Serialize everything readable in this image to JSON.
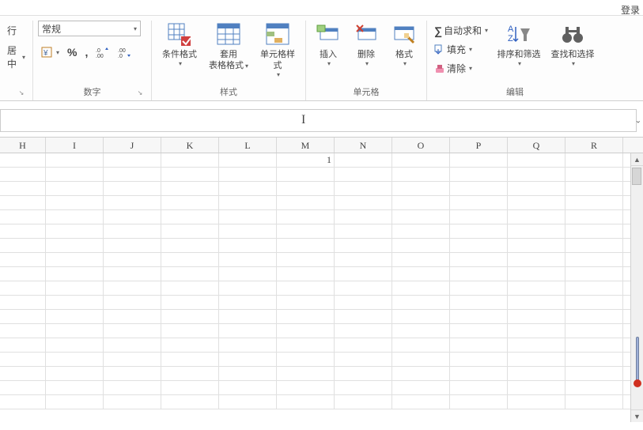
{
  "topbar": {
    "login_label": "登录"
  },
  "ribbon": {
    "alignment": {
      "wrap_label": "行",
      "merge_label": "居中",
      "group_label": ""
    },
    "number": {
      "format_selected": "常规",
      "group_label": "数字"
    },
    "styles": {
      "conditional_label": "条件格式",
      "table_format_label1": "套用",
      "table_format_label2": "表格格式",
      "cell_style_label": "单元格样式",
      "group_label": "样式"
    },
    "cells": {
      "insert_label": "插入",
      "delete_label": "删除",
      "format_label": "格式",
      "group_label": "单元格"
    },
    "editing": {
      "autosum_label": "自动求和",
      "fill_label": "填充",
      "clear_label": "清除",
      "sort_filter_label": "排序和筛选",
      "find_select_label": "查找和选择",
      "group_label": "编辑"
    }
  },
  "columns": [
    "H",
    "I",
    "J",
    "K",
    "L",
    "M",
    "N",
    "O",
    "P",
    "Q",
    "R"
  ],
  "grid": {
    "rows": 18,
    "cells": {
      "0,5": "1"
    }
  }
}
